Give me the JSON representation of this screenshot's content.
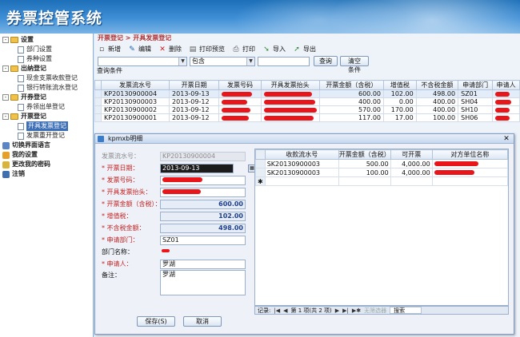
{
  "app": {
    "title": "券票控管系统"
  },
  "sidebar": {
    "groups": [
      {
        "label": "设置",
        "expand": "-",
        "items": [
          "部门设置",
          "券种设置"
        ]
      },
      {
        "label": "出纳登记",
        "expand": "-",
        "items": [
          "现金支票收款登记",
          "银行转账流水登记"
        ]
      },
      {
        "label": "开券登记",
        "expand": "-",
        "items": [
          "券领出单登记"
        ]
      },
      {
        "label": "开票登记",
        "expand": "-",
        "items": [
          "开具发票登记",
          "发票重开登记"
        ]
      }
    ],
    "selected_item": "开具发票登记",
    "leaves": [
      "切换界面语言",
      "我的设置",
      "更改我的密码",
      "注销"
    ]
  },
  "breadcrumb": "开票登记 > 开具发票登记",
  "toolbar": {
    "new": "新增",
    "edit": "编辑",
    "delete": "删除",
    "print_preview": "打印预览",
    "print": "打印",
    "import": "导入",
    "export": "导出"
  },
  "filter": {
    "field": "",
    "operator": "包含",
    "value": "",
    "query_btn": "查询",
    "clear_btn": "清空条件"
  },
  "query_section_label": "查询条件",
  "grid": {
    "columns": [
      "发票流水号",
      "开票日期",
      "发票号码",
      "开具发票抬头",
      "开票金额（含税）",
      "增值税",
      "不含税金额",
      "申请部门",
      "申请人"
    ],
    "rows": [
      [
        "KP20130900004",
        "2013-09-13",
        "",
        "",
        "600.00",
        "102.00",
        "498.00",
        "SZ01",
        ""
      ],
      [
        "KP20130900003",
        "2013-09-12",
        "",
        "",
        "400.00",
        "0.00",
        "400.00",
        "SH04",
        ""
      ],
      [
        "KP20130900002",
        "2013-09-12",
        "",
        "",
        "570.00",
        "170.00",
        "400.00",
        "SH10",
        ""
      ],
      [
        "KP20130900001",
        "2013-09-12",
        "",
        "",
        "117.00",
        "17.00",
        "100.00",
        "SH06",
        ""
      ]
    ]
  },
  "dialog": {
    "title": "kpmxb明细",
    "close": "✕",
    "fields": {
      "serial_label": "发票流水号：",
      "serial_value": "KP20130900004",
      "date_label": "* 开票日期：",
      "date_value": "2013-09-13",
      "number_label": "* 发票号码：",
      "number_value": "",
      "header_label": "* 开具发票抬头：",
      "header_value": "",
      "amount_label": "* 开票金额（含税）：",
      "amount_value": "600.00",
      "vat_label": "* 增值税：",
      "vat_value": "102.00",
      "net_label": "* 不含税金额：",
      "net_value": "498.00",
      "dept_label": "* 申请部门：",
      "dept_value": "SZ01",
      "deptname_label": "部门名称：",
      "deptname_value": "",
      "applicant_label": "* 申请人：",
      "applicant_value": "罗湖",
      "note_label": "备注：",
      "note_value": "罗湖"
    },
    "subgrid": {
      "columns": [
        "收款流水号",
        "开票金额（含税）",
        "可开票",
        "对方单位名称"
      ],
      "rows": [
        [
          "SK20130900003",
          "500.00",
          "4,000.00",
          ""
        ],
        [
          "SK20130900003",
          "100.00",
          "4,000.00",
          ""
        ]
      ],
      "new_row_marker": "✱"
    },
    "navbar": {
      "label": "记录:",
      "first": "|◀",
      "prev": "◀",
      "position": "第 1 项(共 2 项)",
      "next": "▶",
      "last": "▶|",
      "new": "▶✱",
      "filter": "无筛选器",
      "search": "搜索"
    },
    "save_btn": "保存(S)",
    "cancel_btn": "取消"
  },
  "colors": {
    "header_blue": "#1c6fb8",
    "required_red": "#c62020",
    "redaction": "#e8151a"
  }
}
